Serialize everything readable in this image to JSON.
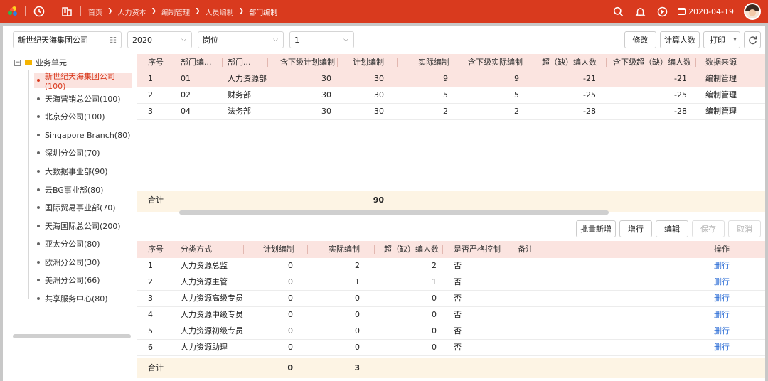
{
  "topbar": {
    "breadcrumbs": [
      "首页",
      "人力资本",
      "编制管理",
      "人员编制",
      "部门编制"
    ],
    "date": "2020-04-19",
    "accent": "#d93a1e"
  },
  "filters": {
    "company": "新世纪天海集团公司",
    "year": "2020",
    "type": "岗位",
    "level": "1"
  },
  "actions": {
    "edit": "修改",
    "calc": "计算人数",
    "print": "打印"
  },
  "tree": {
    "root": "业务单元",
    "items": [
      "新世纪天海集团公司(100)",
      "天海营销总公司(100)",
      "北京分公司(100)",
      "Singapore Branch(80)",
      "深圳分公司(70)",
      "大数据事业部(90)",
      "云BG事业部(80)",
      "国际贸易事业部(70)",
      "天海国际总公司(200)",
      "亚太分公司(80)",
      "欧洲分公司(30)",
      "美洲分公司(66)",
      "共享服务中心(80)"
    ]
  },
  "table1": {
    "headers": [
      "序号",
      "部门编...",
      "部门...",
      "含下级计划编制",
      "计划编制",
      "实际编制",
      "含下级实际编制",
      "超（缺）编人数",
      "含下级超（缺）编人数",
      "数据来源"
    ],
    "rows": [
      [
        "1",
        "01",
        "人力资源部",
        "30",
        "30",
        "9",
        "9",
        "-21",
        "-21",
        "编制管理"
      ],
      [
        "2",
        "02",
        "财务部",
        "30",
        "30",
        "5",
        "5",
        "-25",
        "-25",
        "编制管理"
      ],
      [
        "3",
        "04",
        "法务部",
        "30",
        "30",
        "2",
        "2",
        "-28",
        "-28",
        "编制管理"
      ]
    ],
    "footer_label": "合计",
    "footer_plan": "90"
  },
  "toolbar2": {
    "batch_add": "批量新增",
    "add_row": "增行",
    "edit": "编辑",
    "save": "保存",
    "cancel": "取消"
  },
  "table2": {
    "headers": [
      "序号",
      "分类方式",
      "计划编制",
      "实际编制",
      "超（缺）编人数",
      "是否严格控制",
      "备注",
      "操作"
    ],
    "rows": [
      [
        "1",
        "人力资源总监",
        "0",
        "2",
        "2",
        "否",
        "",
        "删行"
      ],
      [
        "2",
        "人力资源主管",
        "0",
        "1",
        "1",
        "否",
        "",
        "删行"
      ],
      [
        "3",
        "人力资源高级专员",
        "0",
        "0",
        "0",
        "否",
        "",
        "删行"
      ],
      [
        "4",
        "人力资源中级专员",
        "0",
        "0",
        "0",
        "否",
        "",
        "删行"
      ],
      [
        "5",
        "人力资源初级专员",
        "0",
        "0",
        "0",
        "否",
        "",
        "删行"
      ],
      [
        "6",
        "人力资源助理",
        "0",
        "0",
        "0",
        "否",
        "",
        "删行"
      ]
    ],
    "footer_label": "合计",
    "footer_plan": "0",
    "footer_actual": "3"
  }
}
